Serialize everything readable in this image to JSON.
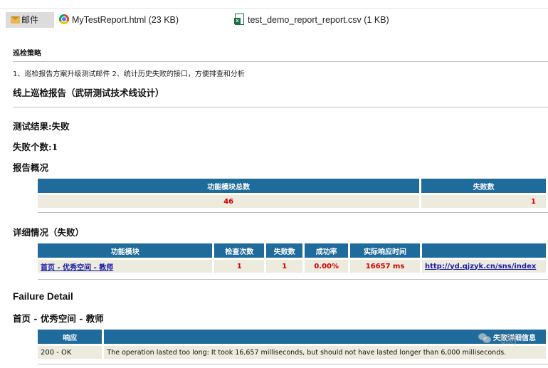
{
  "attachments_bar": {
    "mail_tab": "邮件",
    "files": [
      {
        "name": "MyTestReport.html (23 KB)",
        "icon": "chrome-icon"
      },
      {
        "name": "test_demo_report_report.csv (1 KB)",
        "icon": "excel-icon"
      }
    ]
  },
  "strategy": {
    "title": "巡检策略",
    "text": "1、巡检报告方案升级测试邮件 2、统计历史失败的接口，方便排查和分析"
  },
  "report_title": "线上巡检报告（武研测试技术线设计）",
  "result": {
    "status_label": "测试结果:失败",
    "fail_count_label": "失败个数:1"
  },
  "overview": {
    "heading": "报告概况",
    "headers": [
      "功能模块总数",
      "失败数"
    ],
    "values": [
      "46",
      "1"
    ]
  },
  "details": {
    "heading": "详细情况（失败）",
    "headers": [
      "功能模块",
      "检查次数",
      "失败数",
      "成功率",
      "实际响应时间",
      ""
    ],
    "rows": [
      {
        "module": "首页 - 优秀空间 - 教师",
        "checks": "1",
        "failures": "1",
        "success_rate": "0.00%",
        "response_time": "16657 ms",
        "url": "http://yd.qjzyk.cn/sns/index"
      }
    ]
  },
  "failure_detail": {
    "heading": "Failure Detail",
    "page": "首页 - 优秀空间 - 教师",
    "headers": [
      "响应",
      "失败详细信息"
    ],
    "rows": [
      {
        "response": "200 - OK",
        "message": "The operation lasted too long: It took 16,657 milliseconds, but should not have lasted longer than 6,000 milliseconds."
      }
    ]
  },
  "watermark": "飞测"
}
